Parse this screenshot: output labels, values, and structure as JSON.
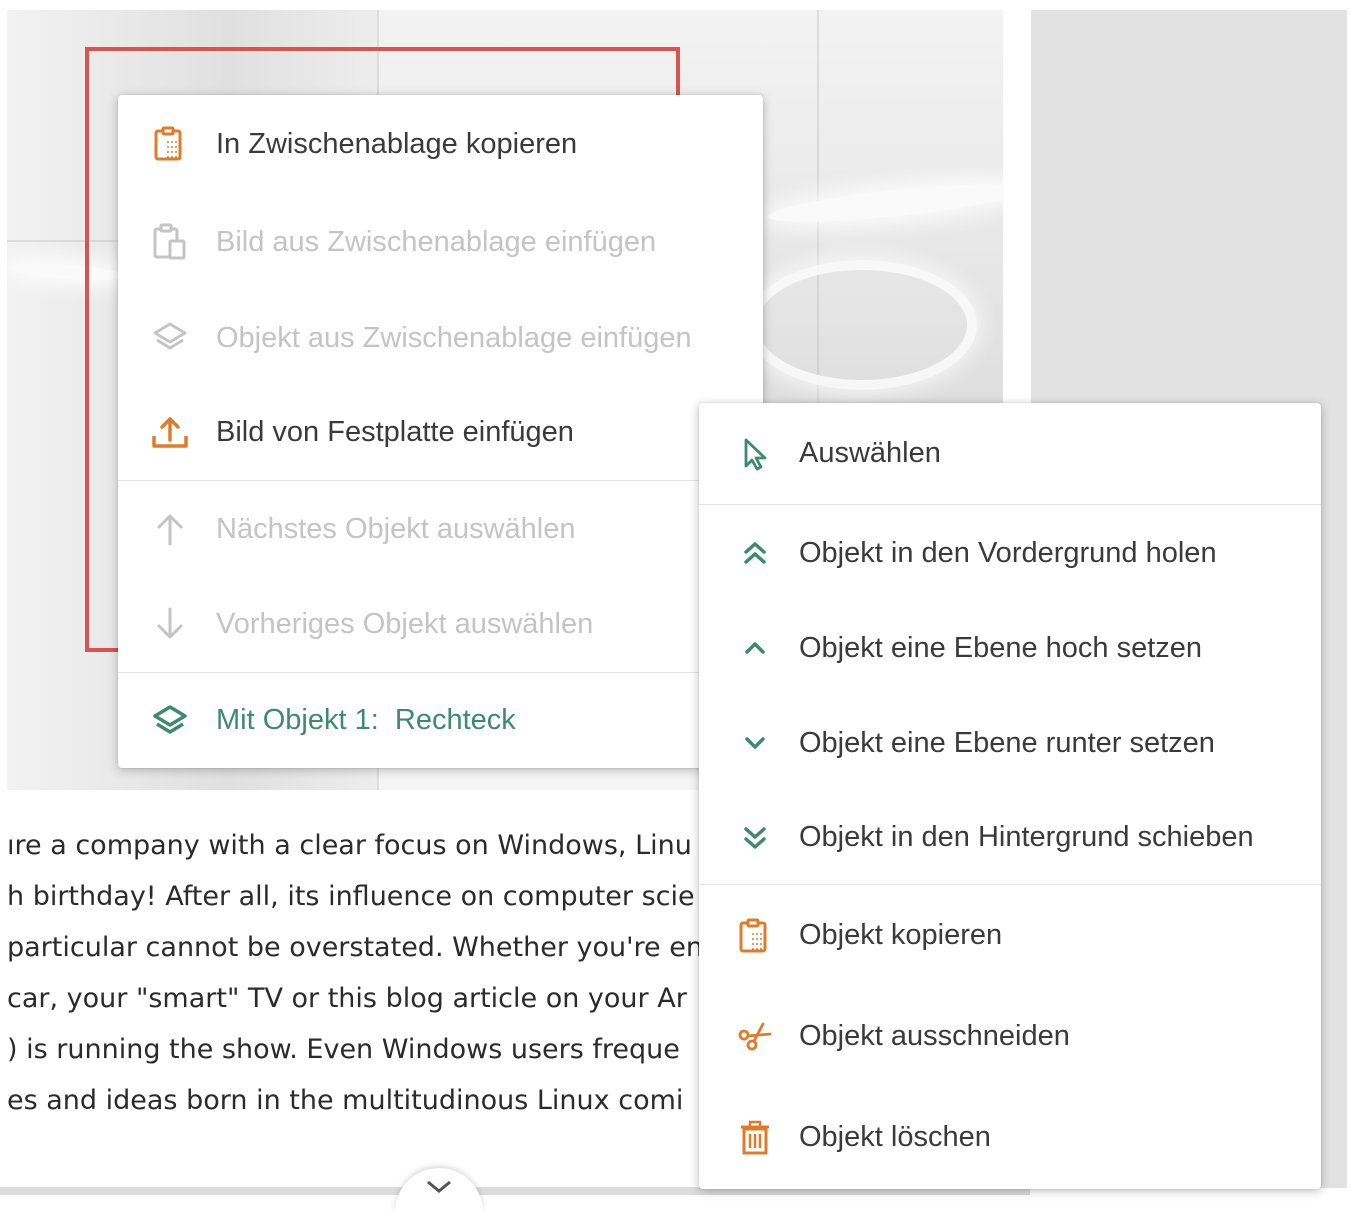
{
  "colors": {
    "icon_orange": "#e07b2a",
    "icon_green": "#3f8a6e",
    "disabled": "#c4c4c4",
    "selection_red": "#d9534f"
  },
  "context_menu": {
    "items": [
      {
        "label": "In Zwischenablage kopieren",
        "icon": "clipboard-copy-icon",
        "enabled": true
      },
      {
        "label": "Bild aus Zwischenablage einfügen",
        "icon": "clipboard-paste-image-icon",
        "enabled": false
      },
      {
        "label": "Objekt aus Zwischenablage einfügen",
        "icon": "layers-icon",
        "enabled": false
      },
      {
        "label": "Bild von Festplatte einfügen",
        "icon": "upload-icon",
        "enabled": true
      },
      {
        "label": "Nächstes Objekt auswählen",
        "icon": "arrow-up-icon",
        "enabled": false
      },
      {
        "label": "Vorheriges Objekt auswählen",
        "icon": "arrow-down-icon",
        "enabled": false
      },
      {
        "label": "Mit Objekt 1:  Rechteck",
        "icon": "layers-icon",
        "enabled": true,
        "has_submenu": true
      }
    ]
  },
  "submenu": {
    "items": [
      {
        "label": "Auswählen",
        "icon": "cursor-icon"
      },
      {
        "label": "Objekt in den Vordergrund holen",
        "icon": "double-chevron-up-icon"
      },
      {
        "label": "Objekt eine Ebene hoch setzen",
        "icon": "chevron-up-icon"
      },
      {
        "label": "Objekt eine Ebene runter setzen",
        "icon": "chevron-down-icon"
      },
      {
        "label": "Objekt in den Hintergrund schieben",
        "icon": "double-chevron-down-icon"
      },
      {
        "label": "Objekt kopieren",
        "icon": "clipboard-copy-icon"
      },
      {
        "label": "Objekt ausschneiden",
        "icon": "scissors-icon"
      },
      {
        "label": "Objekt löschen",
        "icon": "trash-icon"
      }
    ]
  },
  "article": {
    "lines": [
      "ıre a company with a clear focus on Windows, Linu",
      "h birthday! After all, its influence on computer scie",
      "particular cannot be overstated. Whether you're en",
      " car, your \"smart\" TV or this blog article on your Ar",
      ") is running the show. Even Windows users freque",
      "es and ideas born in the multitudinous Linux comi"
    ]
  }
}
